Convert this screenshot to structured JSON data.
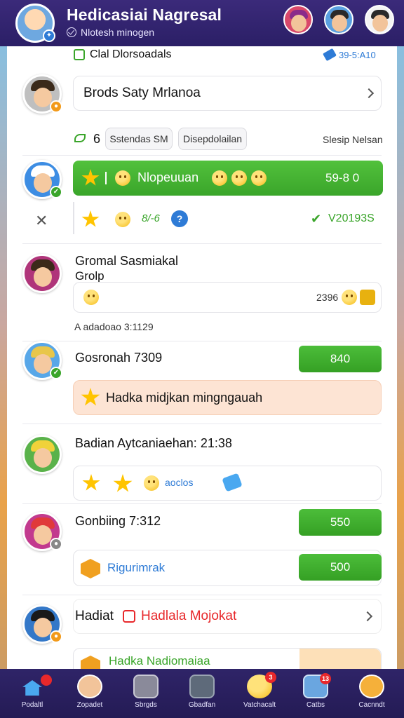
{
  "header": {
    "title": "Hedicasiai Nagresal",
    "subtitle": "Nlotesh minogen",
    "profile_badge": "✦"
  },
  "top_strip": {
    "left_label": "Clal Dlorsoadals",
    "right_label": "39-5:A10"
  },
  "rows": [
    {
      "box_text": "Brods Saty Mrlanoa"
    },
    {
      "count": "6",
      "chip1": "Sstendas SM",
      "chip2": "Disepdolailan",
      "right_text": "Slesip Nelsan"
    },
    {
      "bar_text": "Nlopeuuan",
      "bar_value": "59-8 0",
      "sub_value": "8/-6",
      "check_value": "V20193S"
    },
    {
      "title_line1": "Gromal Sasmiakal",
      "title_line2": "Grolp",
      "box_right": "2396",
      "caption": "A adadoao 3:1129"
    },
    {
      "name": "Gosronah 7309",
      "button": "840",
      "peach_text": "Hadka midjkan mingngauah"
    },
    {
      "title": "Badian Aytcaniaehan: 21:38",
      "tag": "aoclos"
    },
    {
      "name": "Gonbiing 7:312",
      "button": "550",
      "sub_label": "Rigurimrak",
      "sub_button": "500"
    },
    {
      "name_black": "Hadiat",
      "name_red": "Hadlala Mojokat",
      "bottom_text": "Hadka Nadiomaiaa"
    }
  ],
  "tabs": [
    {
      "label": "Podaltl",
      "badge": ""
    },
    {
      "label": "Zopadet",
      "badge": ""
    },
    {
      "label": "Sbrgds",
      "badge": ""
    },
    {
      "label": "Gbadfan",
      "badge": ""
    },
    {
      "label": "Vatchacalt",
      "badge": "3"
    },
    {
      "label": "Catbs",
      "badge": "13"
    },
    {
      "label": "Cacnndt",
      "badge": ""
    }
  ],
  "colors": {
    "header_bg": "#2b1f66",
    "accent_green": "#3aa52a",
    "alert_red": "#e8282b",
    "link_blue": "#2e7bd6",
    "peach": "#fde4d4"
  }
}
